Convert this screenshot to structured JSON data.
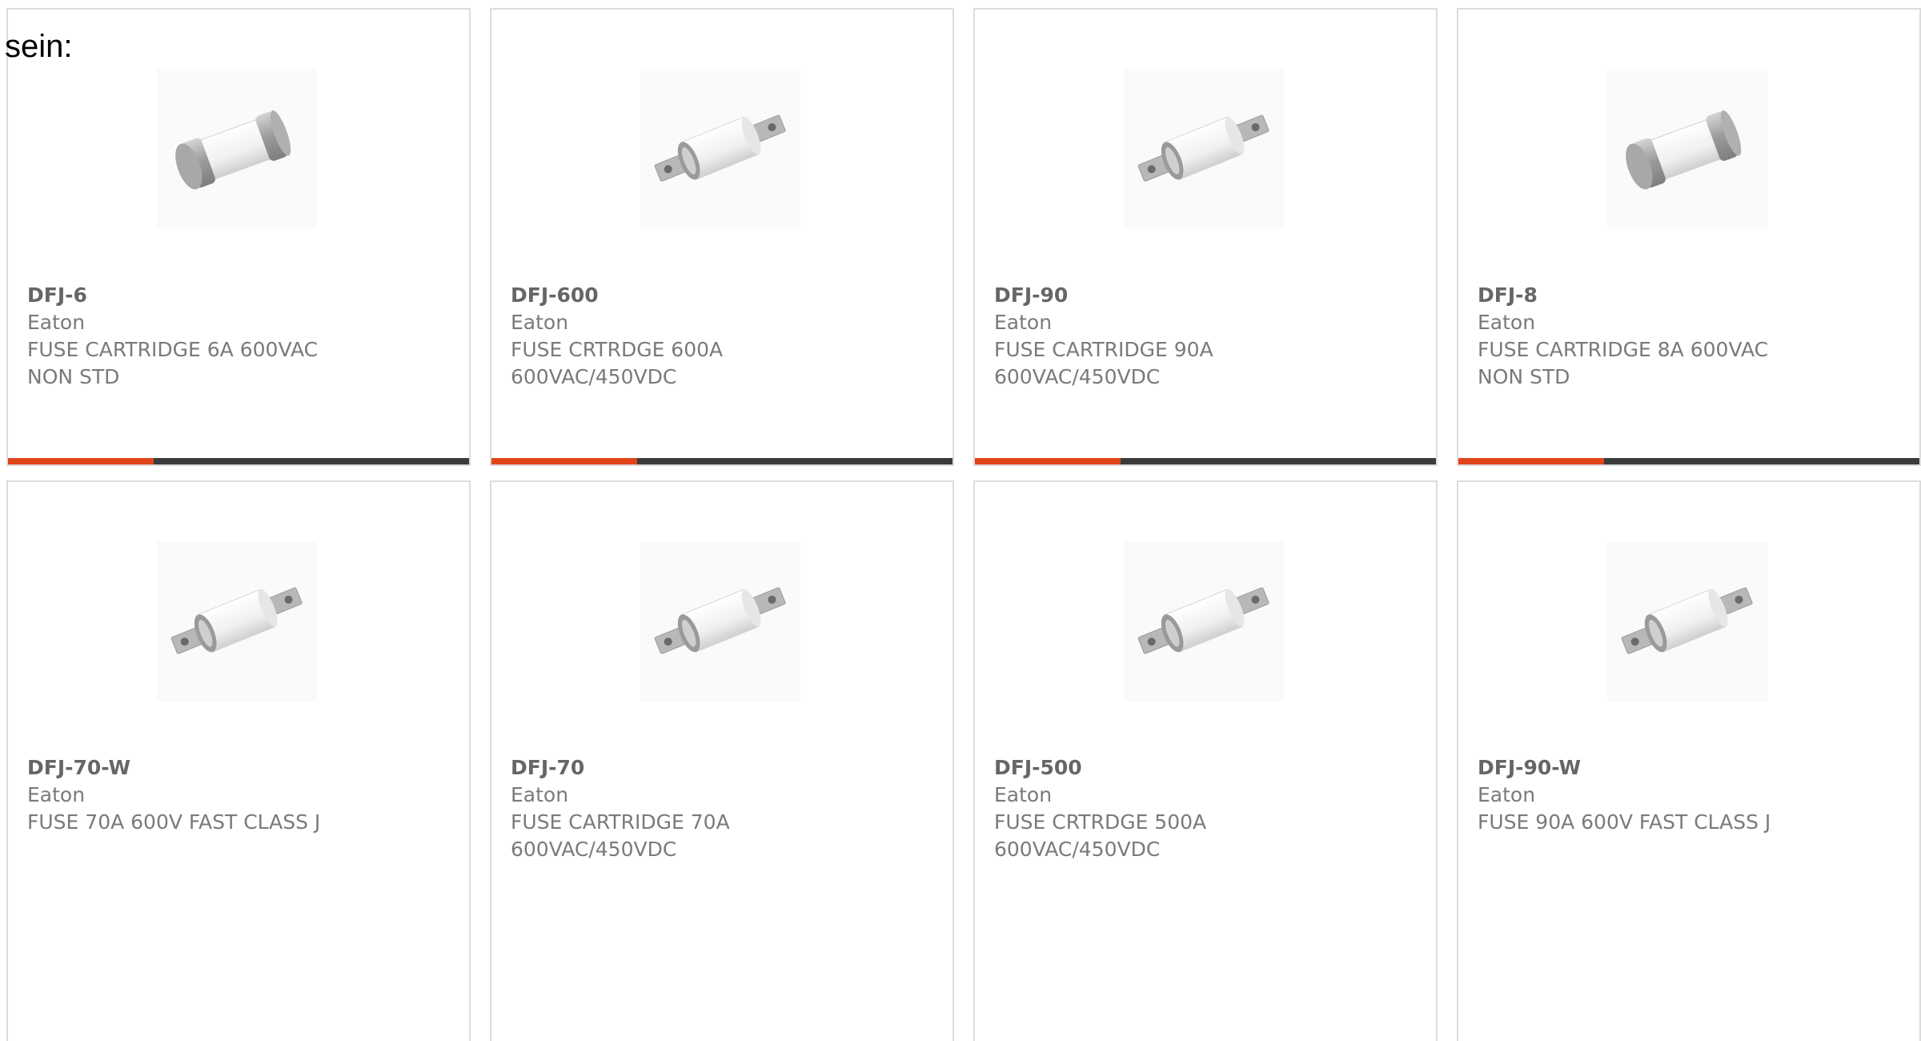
{
  "lead_text": "sein:",
  "products": [
    {
      "part": "DFJ-6",
      "manufacturer": "Eaton",
      "description": "FUSE CARTRIDGE 6A 600VAC NON STD",
      "image": "cylinder-fuse-icon"
    },
    {
      "part": "DFJ-600",
      "manufacturer": "Eaton",
      "description": "FUSE CRTRDGE 600A 600VAC/450VDC",
      "image": "bolt-tab-fuse-icon"
    },
    {
      "part": "DFJ-90",
      "manufacturer": "Eaton",
      "description": "FUSE CARTRIDGE 90A 600VAC/450VDC",
      "image": "bolt-tab-fuse-icon"
    },
    {
      "part": "DFJ-8",
      "manufacturer": "Eaton",
      "description": "FUSE CARTRIDGE 8A 600VAC NON STD",
      "image": "cylinder-fuse-icon"
    },
    {
      "part": "DFJ-70-W",
      "manufacturer": "Eaton",
      "description": "FUSE 70A 600V FAST CLASS J",
      "image": "bolt-tab-fuse-icon"
    },
    {
      "part": "DFJ-70",
      "manufacturer": "Eaton",
      "description": "FUSE CARTRIDGE 70A 600VAC/450VDC",
      "image": "bolt-tab-fuse-icon"
    },
    {
      "part": "DFJ-500",
      "manufacturer": "Eaton",
      "description": "FUSE CRTRDGE 500A 600VAC/450VDC",
      "image": "bolt-tab-fuse-icon"
    },
    {
      "part": "DFJ-90-W",
      "manufacturer": "Eaton",
      "description": "FUSE 90A 600V FAST CLASS J",
      "image": "bolt-tab-fuse-icon"
    }
  ],
  "colors": {
    "accent": "#e0451a",
    "bar": "#3b3b3b",
    "border": "#dcdcdc",
    "text": "#7a7a7a"
  }
}
